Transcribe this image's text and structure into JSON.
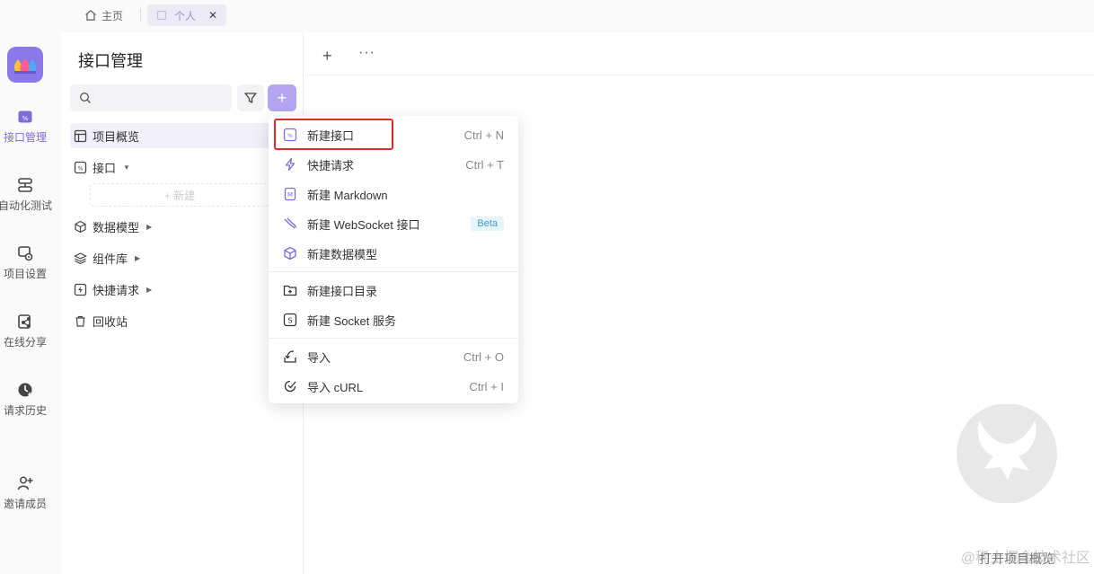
{
  "tabs": {
    "home_label": "主页",
    "active_label": "个人",
    "close": "✕"
  },
  "rail": {
    "items": [
      {
        "label": "接口管理",
        "icon": "api-icon"
      },
      {
        "label": "自动化测试",
        "icon": "layers-icon"
      },
      {
        "label": "项目设置",
        "icon": "settings-icon"
      },
      {
        "label": "在线分享",
        "icon": "share-icon"
      },
      {
        "label": "请求历史",
        "icon": "history-icon"
      },
      {
        "label": "邀请成员",
        "icon": "add-user-icon"
      }
    ]
  },
  "panel": {
    "title": "接口管理",
    "search_placeholder": "",
    "plus": "+",
    "tree": [
      {
        "label": "项目概览",
        "icon": "overview-icon"
      },
      {
        "label": "接口",
        "icon": "api-icon"
      },
      {
        "label": "数据模型",
        "icon": "cube-icon"
      },
      {
        "label": "组件库",
        "icon": "layers-icon"
      },
      {
        "label": "快捷请求",
        "icon": "bolt-icon"
      },
      {
        "label": "回收站",
        "icon": "trash-icon"
      }
    ],
    "new_sub": "+ 新建"
  },
  "main": {
    "plus": "+",
    "more": "···"
  },
  "menu": {
    "items": [
      {
        "label": "新建接口",
        "shortcut": "Ctrl + N",
        "icon": "api-icon"
      },
      {
        "label": "快捷请求",
        "shortcut": "Ctrl + T",
        "icon": "bolt-icon"
      },
      {
        "label": "新建 Markdown",
        "shortcut": "",
        "icon": "markdown-icon"
      },
      {
        "label": "新建 WebSocket 接口",
        "badge": "Beta",
        "icon": "websocket-icon"
      },
      {
        "label": "新建数据模型",
        "shortcut": "",
        "icon": "cube-icon"
      },
      {
        "label": "新建接口目录",
        "shortcut": "",
        "icon": "folder-plus-icon"
      },
      {
        "label": "新建 Socket 服务",
        "shortcut": "",
        "icon": "socket-icon"
      },
      {
        "label": "导入",
        "shortcut": "Ctrl + O",
        "icon": "import-icon"
      },
      {
        "label": "导入 cURL",
        "shortcut": "Ctrl + I",
        "icon": "curl-icon"
      }
    ]
  },
  "watermark": {
    "text": "@稀土掘金技术社区",
    "overlay": "打开项目概览"
  },
  "colors": {
    "accent": "#7c6bd9",
    "plus_button": "#b3a5f1",
    "highlight": "#e02b2b"
  }
}
